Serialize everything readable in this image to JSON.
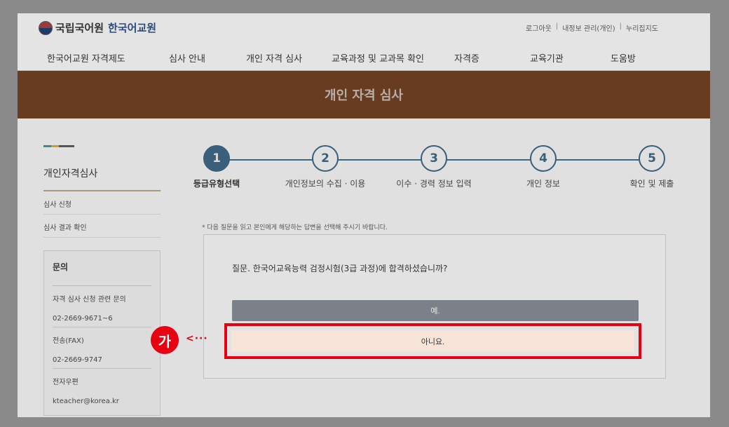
{
  "header": {
    "org_name": "국립국어원",
    "site_name": "한국어교원",
    "util_links": [
      "로그아웃",
      "내정보 관리(개인)",
      "누리집지도"
    ]
  },
  "nav": {
    "items": [
      "한국어교원 자격제도",
      "심사 안내",
      "개인 자격 심사",
      "교육과정 및 교과목 확인",
      "자격증",
      "교육기관",
      "도움방"
    ]
  },
  "banner": {
    "title": "개인 자격 심사"
  },
  "sidebar": {
    "title": "개인자격심사",
    "items": [
      "심사 신청",
      "심사 결과 확인"
    ],
    "contact": {
      "title": "문의",
      "rows": [
        "자격 심사 신청 관련 문의",
        "02-2669-9671~6",
        "전송(FAX)",
        "02-2669-9747",
        "전자우편",
        "kteacher@korea.kr"
      ]
    }
  },
  "steps": [
    {
      "num": "1",
      "label": "등급유형선택"
    },
    {
      "num": "2",
      "label": "개인정보의 수집 · 이용"
    },
    {
      "num": "3",
      "label": "이수 · 경력 정보 입력"
    },
    {
      "num": "4",
      "label": "개인 정보"
    },
    {
      "num": "5",
      "label": "확인 및 제출"
    }
  ],
  "form": {
    "instruction": "* 다음 질문을 읽고 본인에게 해당하는 답변을 선택해 주시기 바랍니다.",
    "question": "질문. 한국어교육능력 검정시험(3급 과정)에 합격하셨습니까?",
    "yes_label": "예.",
    "no_label": "아니요."
  },
  "callout": {
    "label": "가"
  },
  "colors": {
    "banner": "#673c21",
    "step_active": "#3a5f7a",
    "highlight": "#e60012",
    "sidebar_accent": [
      "#3a8a8a",
      "#c8a020",
      "#555555"
    ]
  }
}
